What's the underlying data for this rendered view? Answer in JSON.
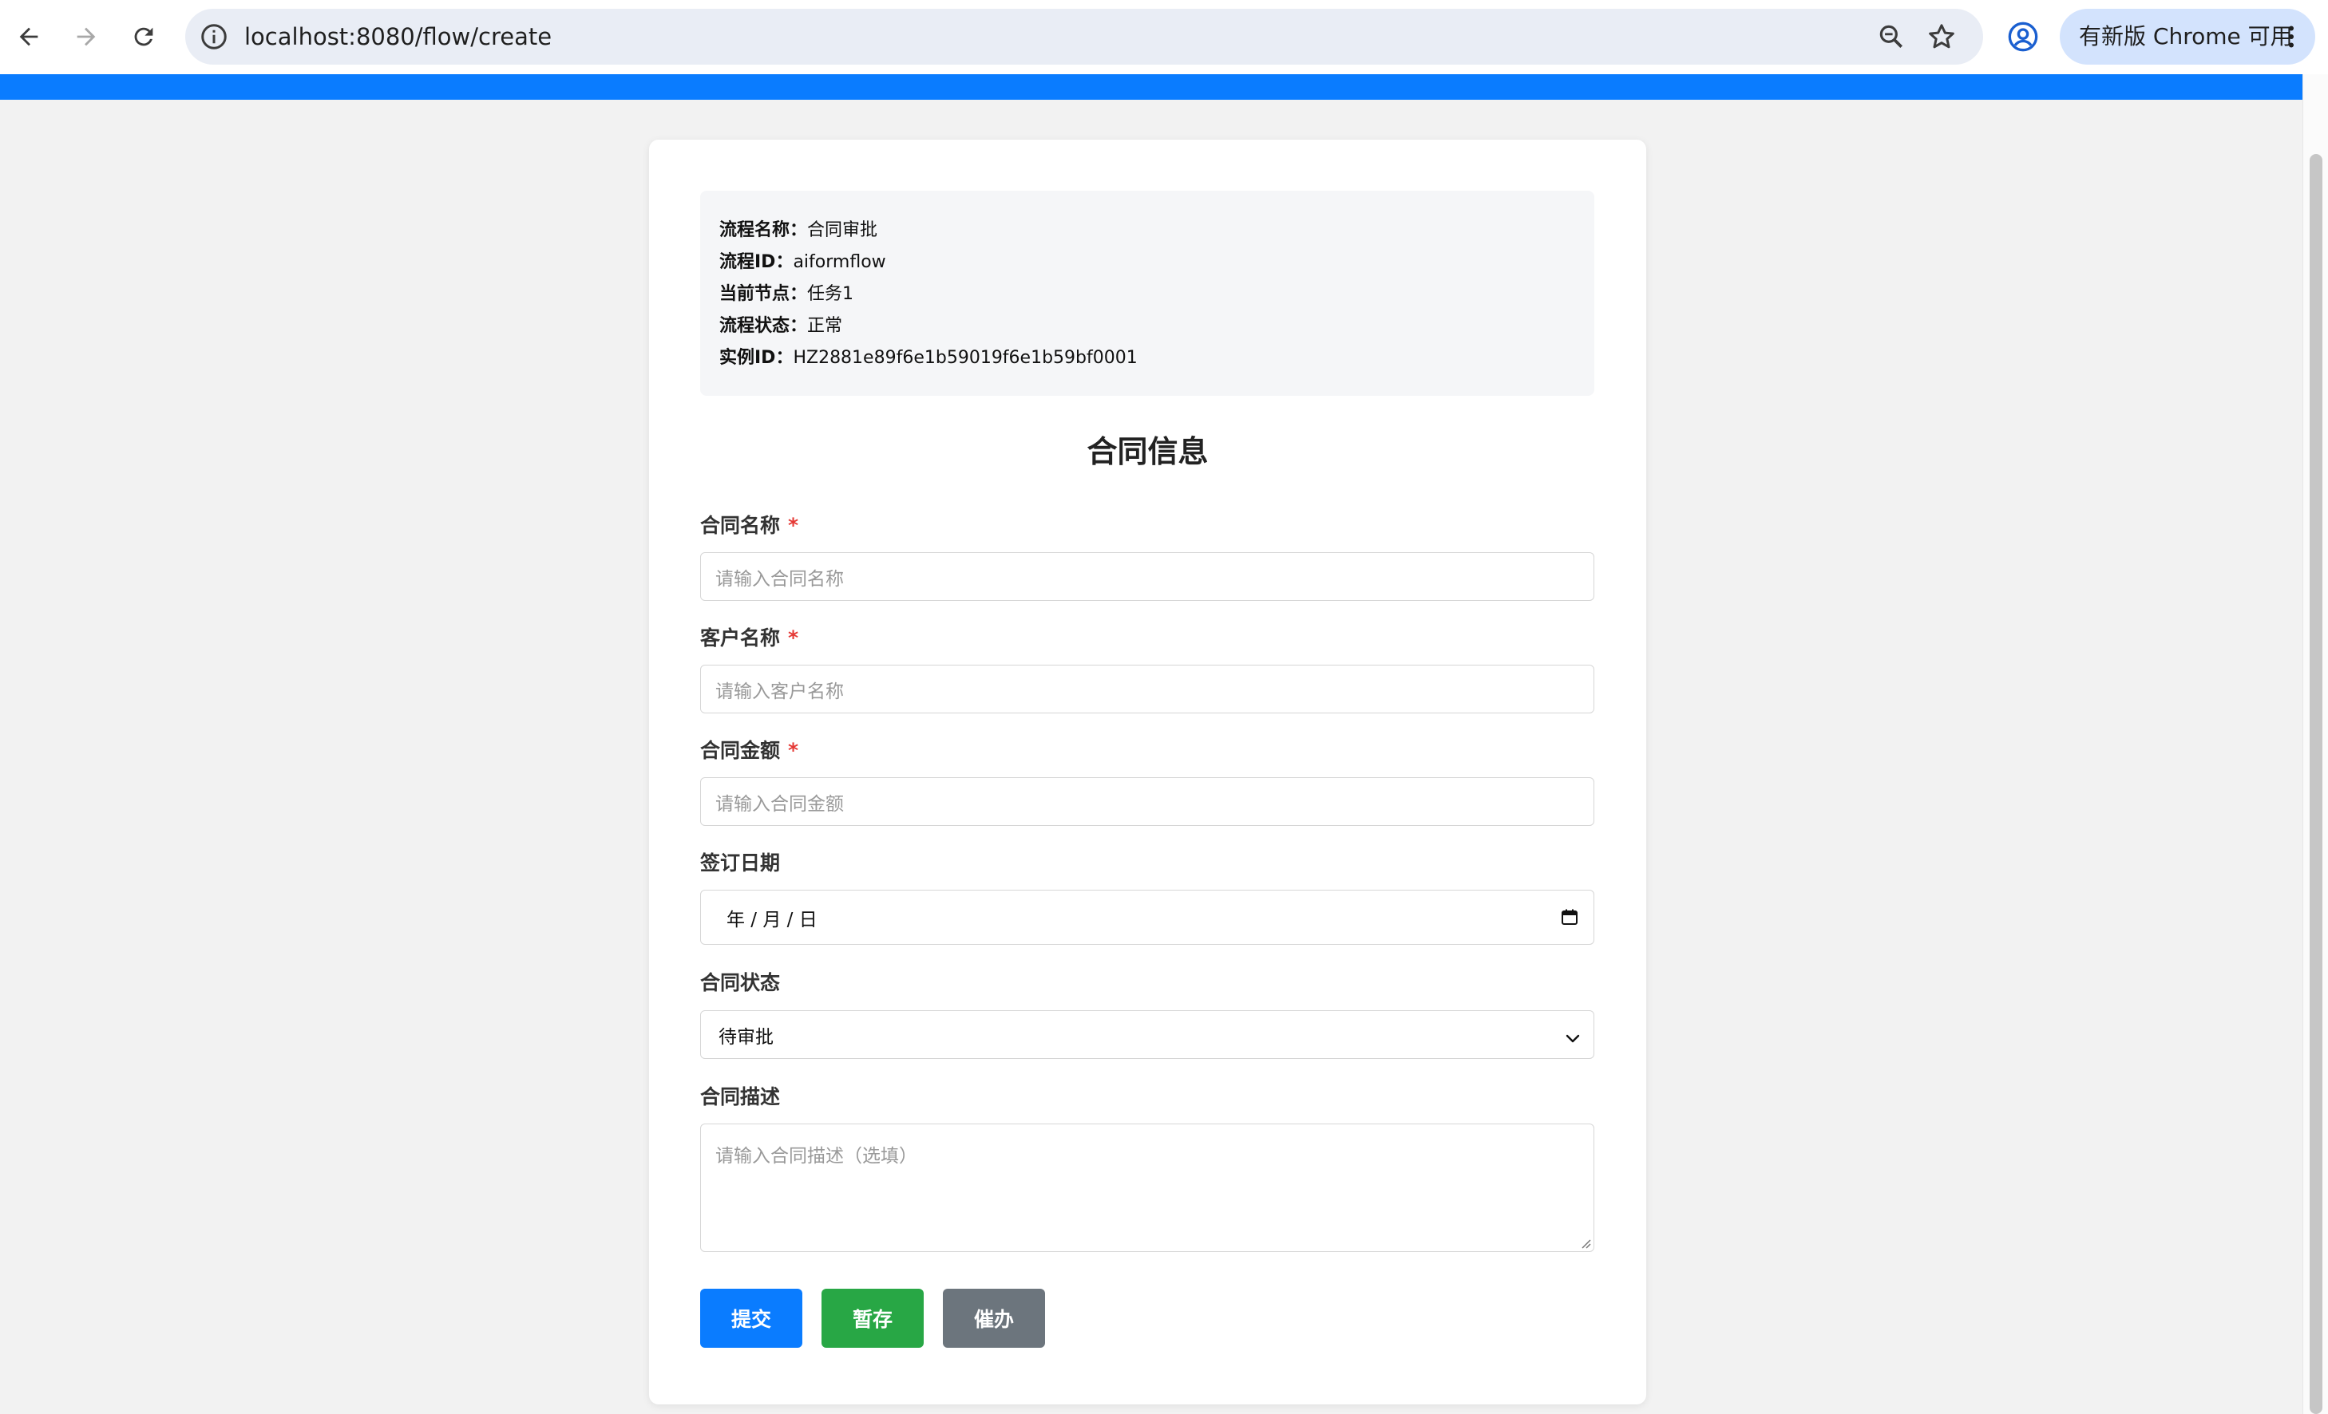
{
  "browser": {
    "url": "localhost:8080/flow/create",
    "update_label": "有新版 Chrome 可用"
  },
  "info": {
    "flow_name_key": "流程名称：",
    "flow_name": "合同审批",
    "flow_id_key": "流程ID：",
    "flow_id": "aiformflow",
    "current_node_key": "当前节点：",
    "current_node": "任务1",
    "flow_status_key": "流程状态：",
    "flow_status": "正常",
    "instance_id_key": "实例ID：",
    "instance_id": "HZ2881e89f6e1b59019f6e1b59bf0001"
  },
  "form": {
    "title": "合同信息",
    "required_mark": "*",
    "contract_name_label": "合同名称",
    "contract_name_placeholder": "请输入合同名称",
    "customer_name_label": "客户名称",
    "customer_name_placeholder": "请输入客户名称",
    "amount_label": "合同金额",
    "amount_placeholder": "请输入合同金额",
    "sign_date_label": "签订日期",
    "sign_date_value": "年 / 月 / 日",
    "status_label": "合同状态",
    "status_value": "待审批",
    "description_label": "合同描述",
    "description_placeholder": "请输入合同描述（选填）"
  },
  "buttons": {
    "submit": "提交",
    "save_draft": "暂存",
    "urge": "催办"
  },
  "colors": {
    "accent_blue": "#0a7cff",
    "submit": "#0a7cff",
    "save_draft": "#28a745",
    "urge": "#6c757d",
    "required": "#e53935"
  }
}
